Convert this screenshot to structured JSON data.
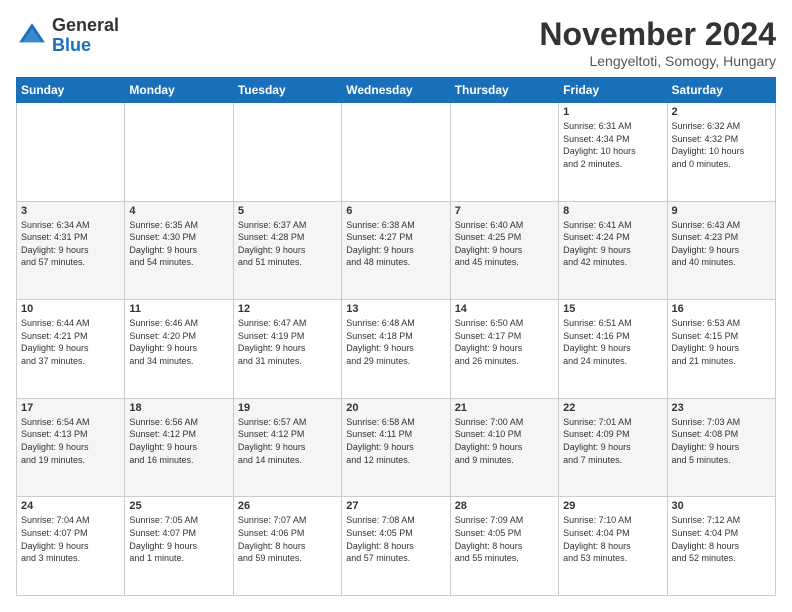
{
  "header": {
    "logo_general": "General",
    "logo_blue": "Blue",
    "month_title": "November 2024",
    "location": "Lengyeltoti, Somogy, Hungary"
  },
  "days_of_week": [
    "Sunday",
    "Monday",
    "Tuesday",
    "Wednesday",
    "Thursday",
    "Friday",
    "Saturday"
  ],
  "weeks": [
    {
      "days": [
        {
          "num": "",
          "info": ""
        },
        {
          "num": "",
          "info": ""
        },
        {
          "num": "",
          "info": ""
        },
        {
          "num": "",
          "info": ""
        },
        {
          "num": "",
          "info": ""
        },
        {
          "num": "1",
          "info": "Sunrise: 6:31 AM\nSunset: 4:34 PM\nDaylight: 10 hours\nand 2 minutes."
        },
        {
          "num": "2",
          "info": "Sunrise: 6:32 AM\nSunset: 4:32 PM\nDaylight: 10 hours\nand 0 minutes."
        }
      ]
    },
    {
      "days": [
        {
          "num": "3",
          "info": "Sunrise: 6:34 AM\nSunset: 4:31 PM\nDaylight: 9 hours\nand 57 minutes."
        },
        {
          "num": "4",
          "info": "Sunrise: 6:35 AM\nSunset: 4:30 PM\nDaylight: 9 hours\nand 54 minutes."
        },
        {
          "num": "5",
          "info": "Sunrise: 6:37 AM\nSunset: 4:28 PM\nDaylight: 9 hours\nand 51 minutes."
        },
        {
          "num": "6",
          "info": "Sunrise: 6:38 AM\nSunset: 4:27 PM\nDaylight: 9 hours\nand 48 minutes."
        },
        {
          "num": "7",
          "info": "Sunrise: 6:40 AM\nSunset: 4:25 PM\nDaylight: 9 hours\nand 45 minutes."
        },
        {
          "num": "8",
          "info": "Sunrise: 6:41 AM\nSunset: 4:24 PM\nDaylight: 9 hours\nand 42 minutes."
        },
        {
          "num": "9",
          "info": "Sunrise: 6:43 AM\nSunset: 4:23 PM\nDaylight: 9 hours\nand 40 minutes."
        }
      ]
    },
    {
      "days": [
        {
          "num": "10",
          "info": "Sunrise: 6:44 AM\nSunset: 4:21 PM\nDaylight: 9 hours\nand 37 minutes."
        },
        {
          "num": "11",
          "info": "Sunrise: 6:46 AM\nSunset: 4:20 PM\nDaylight: 9 hours\nand 34 minutes."
        },
        {
          "num": "12",
          "info": "Sunrise: 6:47 AM\nSunset: 4:19 PM\nDaylight: 9 hours\nand 31 minutes."
        },
        {
          "num": "13",
          "info": "Sunrise: 6:48 AM\nSunset: 4:18 PM\nDaylight: 9 hours\nand 29 minutes."
        },
        {
          "num": "14",
          "info": "Sunrise: 6:50 AM\nSunset: 4:17 PM\nDaylight: 9 hours\nand 26 minutes."
        },
        {
          "num": "15",
          "info": "Sunrise: 6:51 AM\nSunset: 4:16 PM\nDaylight: 9 hours\nand 24 minutes."
        },
        {
          "num": "16",
          "info": "Sunrise: 6:53 AM\nSunset: 4:15 PM\nDaylight: 9 hours\nand 21 minutes."
        }
      ]
    },
    {
      "days": [
        {
          "num": "17",
          "info": "Sunrise: 6:54 AM\nSunset: 4:13 PM\nDaylight: 9 hours\nand 19 minutes."
        },
        {
          "num": "18",
          "info": "Sunrise: 6:56 AM\nSunset: 4:12 PM\nDaylight: 9 hours\nand 16 minutes."
        },
        {
          "num": "19",
          "info": "Sunrise: 6:57 AM\nSunset: 4:12 PM\nDaylight: 9 hours\nand 14 minutes."
        },
        {
          "num": "20",
          "info": "Sunrise: 6:58 AM\nSunset: 4:11 PM\nDaylight: 9 hours\nand 12 minutes."
        },
        {
          "num": "21",
          "info": "Sunrise: 7:00 AM\nSunset: 4:10 PM\nDaylight: 9 hours\nand 9 minutes."
        },
        {
          "num": "22",
          "info": "Sunrise: 7:01 AM\nSunset: 4:09 PM\nDaylight: 9 hours\nand 7 minutes."
        },
        {
          "num": "23",
          "info": "Sunrise: 7:03 AM\nSunset: 4:08 PM\nDaylight: 9 hours\nand 5 minutes."
        }
      ]
    },
    {
      "days": [
        {
          "num": "24",
          "info": "Sunrise: 7:04 AM\nSunset: 4:07 PM\nDaylight: 9 hours\nand 3 minutes."
        },
        {
          "num": "25",
          "info": "Sunrise: 7:05 AM\nSunset: 4:07 PM\nDaylight: 9 hours\nand 1 minute."
        },
        {
          "num": "26",
          "info": "Sunrise: 7:07 AM\nSunset: 4:06 PM\nDaylight: 8 hours\nand 59 minutes."
        },
        {
          "num": "27",
          "info": "Sunrise: 7:08 AM\nSunset: 4:05 PM\nDaylight: 8 hours\nand 57 minutes."
        },
        {
          "num": "28",
          "info": "Sunrise: 7:09 AM\nSunset: 4:05 PM\nDaylight: 8 hours\nand 55 minutes."
        },
        {
          "num": "29",
          "info": "Sunrise: 7:10 AM\nSunset: 4:04 PM\nDaylight: 8 hours\nand 53 minutes."
        },
        {
          "num": "30",
          "info": "Sunrise: 7:12 AM\nSunset: 4:04 PM\nDaylight: 8 hours\nand 52 minutes."
        }
      ]
    }
  ]
}
